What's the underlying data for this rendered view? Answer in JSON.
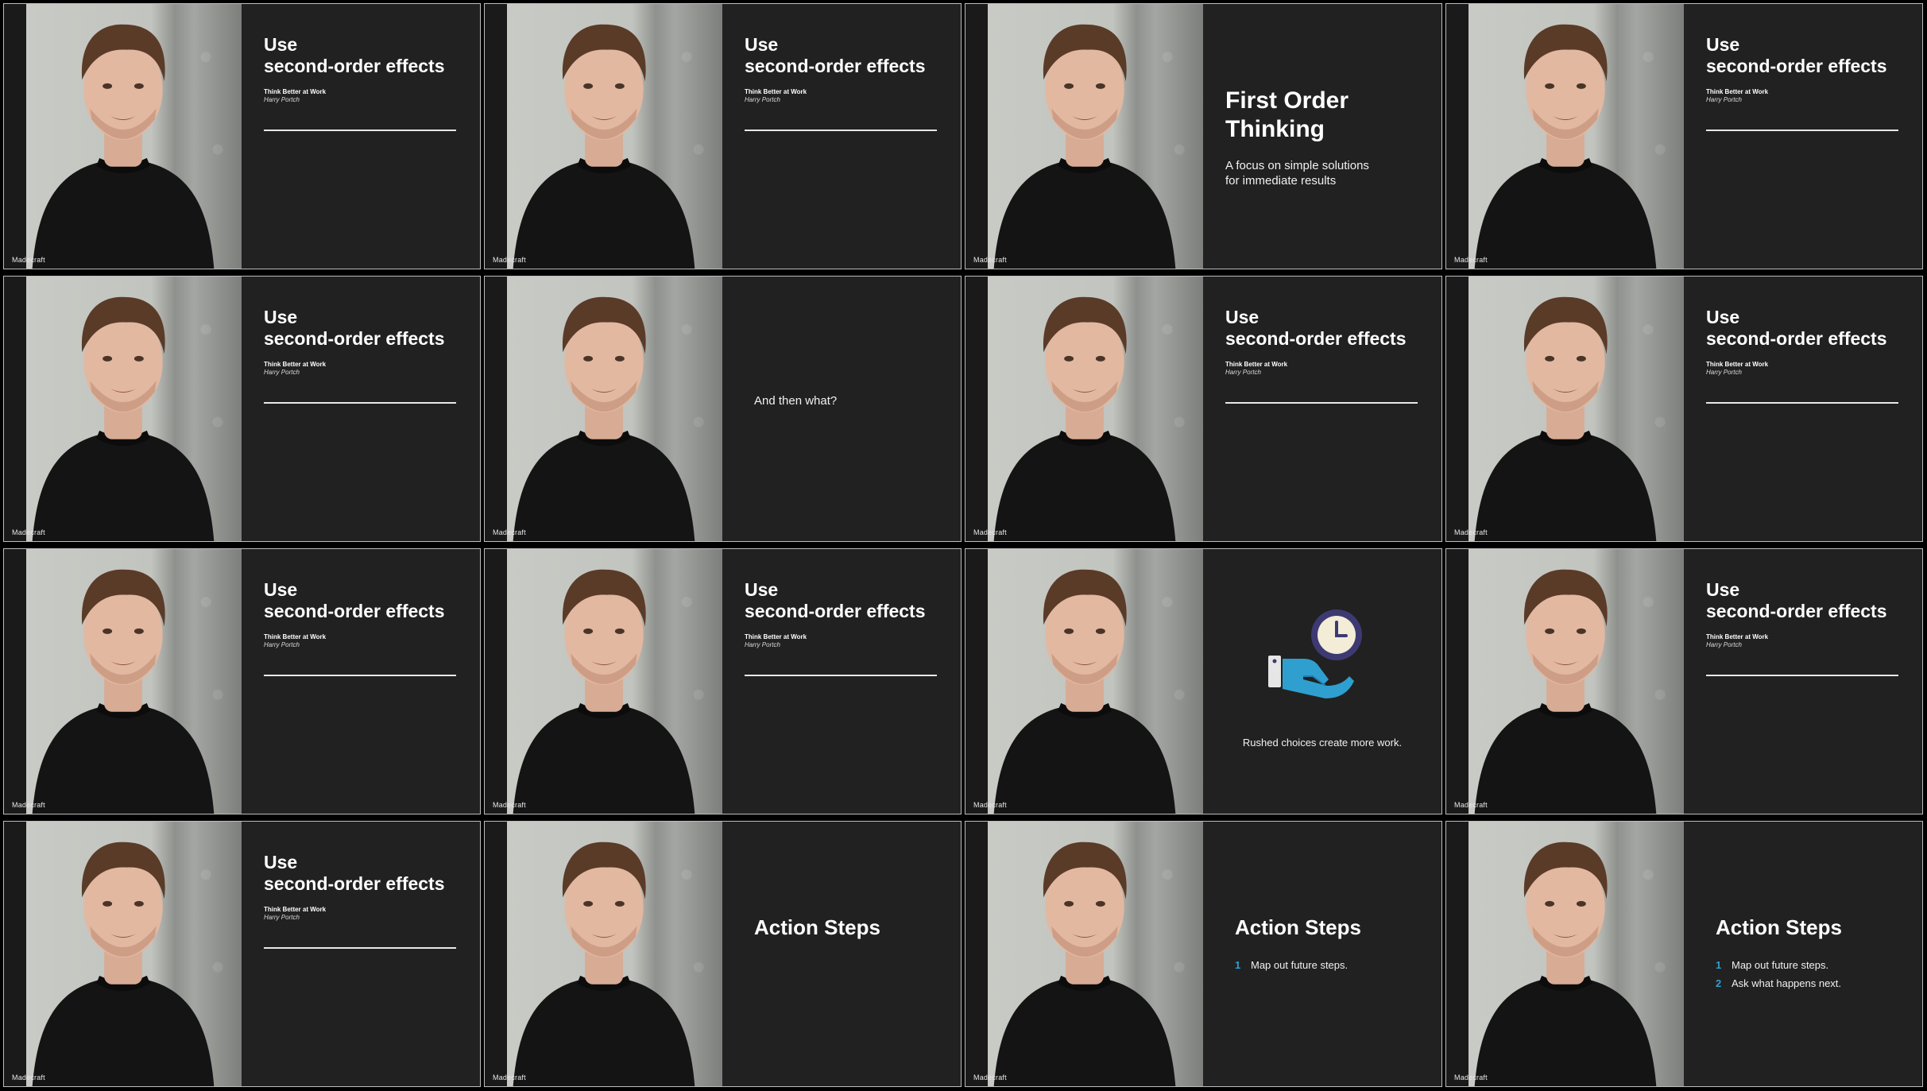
{
  "brand": "Madecraft",
  "slide": {
    "title_line1": "Use",
    "title_line2": "second-order effects",
    "subtitle": "Think Better at Work",
    "author": "Harry Portch"
  },
  "first_order": {
    "title_line1": "First Order",
    "title_line2": "Thinking",
    "text_line1": "A focus on simple solutions",
    "text_line2": "for immediate results"
  },
  "question": "And then what?",
  "rushed": {
    "caption": "Rushed choices create more work.",
    "icon": "hand-with-clock-icon"
  },
  "action": {
    "title": "Action Steps",
    "steps": [
      {
        "num": "1",
        "text": "Map out future steps."
      },
      {
        "num": "2",
        "text": "Ask what happens next."
      }
    ]
  },
  "colors": {
    "panel": "#212121",
    "accent": "#2f9fd0",
    "clock": "#3d3a72"
  }
}
